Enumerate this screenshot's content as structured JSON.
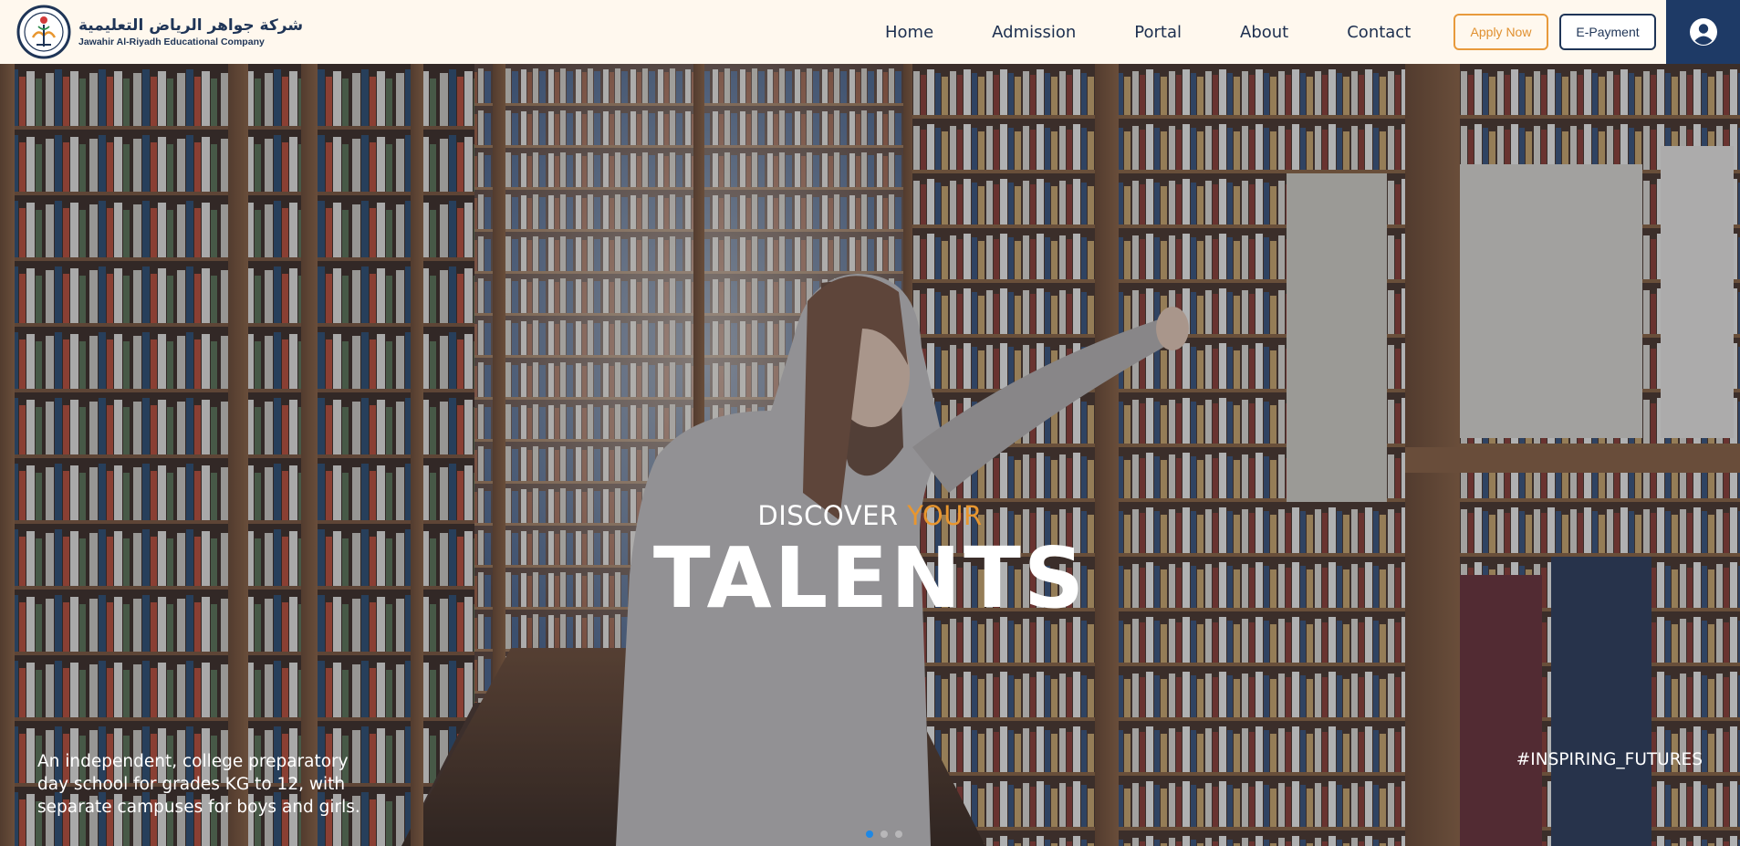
{
  "brand": {
    "name_ar": "شركة جواهر الرياض التعليمية",
    "name_en": "Jawahir Al-Riyadh Educational Company",
    "logo_icon": "school-seal-icon"
  },
  "nav": {
    "items": [
      {
        "label": "Home"
      },
      {
        "label": "Admission"
      },
      {
        "label": "Portal"
      },
      {
        "label": "About"
      },
      {
        "label": "Contact"
      }
    ],
    "apply_label": "Apply Now",
    "payment_label": "E-Payment",
    "account_icon": "user-account-icon"
  },
  "hero": {
    "discover": "DISCOVER",
    "discover_accent": "YOUR",
    "headline": "TALENTS",
    "tagline": "An independent, college preparatory day school for grades KG to 12, with separate campuses for boys and girls.",
    "hashtag": "#INSPIRING_FUTURES",
    "slide_count": 3,
    "active_slide": 1
  },
  "colors": {
    "header_bg": "#fff8ee",
    "brand_navy": "#1f3557",
    "accent_orange": "#e8962f",
    "account_bg": "#1e3a66",
    "active_dot": "#1e88e5"
  }
}
